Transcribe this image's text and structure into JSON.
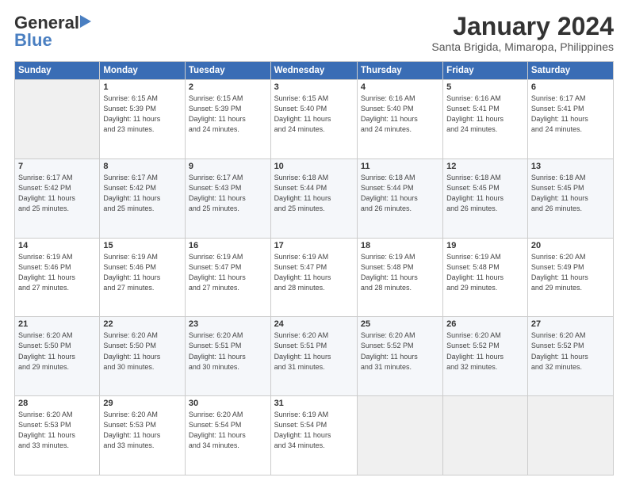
{
  "header": {
    "logo_line1": "General",
    "logo_line2": "Blue",
    "title": "January 2024",
    "subtitle": "Santa Brigida, Mimaropa, Philippines"
  },
  "calendar": {
    "days_of_week": [
      "Sunday",
      "Monday",
      "Tuesday",
      "Wednesday",
      "Thursday",
      "Friday",
      "Saturday"
    ],
    "weeks": [
      [
        {
          "day": "",
          "info": ""
        },
        {
          "day": "1",
          "info": "Sunrise: 6:15 AM\nSunset: 5:39 PM\nDaylight: 11 hours\nand 23 minutes."
        },
        {
          "day": "2",
          "info": "Sunrise: 6:15 AM\nSunset: 5:39 PM\nDaylight: 11 hours\nand 24 minutes."
        },
        {
          "day": "3",
          "info": "Sunrise: 6:15 AM\nSunset: 5:40 PM\nDaylight: 11 hours\nand 24 minutes."
        },
        {
          "day": "4",
          "info": "Sunrise: 6:16 AM\nSunset: 5:40 PM\nDaylight: 11 hours\nand 24 minutes."
        },
        {
          "day": "5",
          "info": "Sunrise: 6:16 AM\nSunset: 5:41 PM\nDaylight: 11 hours\nand 24 minutes."
        },
        {
          "day": "6",
          "info": "Sunrise: 6:17 AM\nSunset: 5:41 PM\nDaylight: 11 hours\nand 24 minutes."
        }
      ],
      [
        {
          "day": "7",
          "info": "Sunrise: 6:17 AM\nSunset: 5:42 PM\nDaylight: 11 hours\nand 25 minutes."
        },
        {
          "day": "8",
          "info": "Sunrise: 6:17 AM\nSunset: 5:42 PM\nDaylight: 11 hours\nand 25 minutes."
        },
        {
          "day": "9",
          "info": "Sunrise: 6:17 AM\nSunset: 5:43 PM\nDaylight: 11 hours\nand 25 minutes."
        },
        {
          "day": "10",
          "info": "Sunrise: 6:18 AM\nSunset: 5:44 PM\nDaylight: 11 hours\nand 25 minutes."
        },
        {
          "day": "11",
          "info": "Sunrise: 6:18 AM\nSunset: 5:44 PM\nDaylight: 11 hours\nand 26 minutes."
        },
        {
          "day": "12",
          "info": "Sunrise: 6:18 AM\nSunset: 5:45 PM\nDaylight: 11 hours\nand 26 minutes."
        },
        {
          "day": "13",
          "info": "Sunrise: 6:18 AM\nSunset: 5:45 PM\nDaylight: 11 hours\nand 26 minutes."
        }
      ],
      [
        {
          "day": "14",
          "info": "Sunrise: 6:19 AM\nSunset: 5:46 PM\nDaylight: 11 hours\nand 27 minutes."
        },
        {
          "day": "15",
          "info": "Sunrise: 6:19 AM\nSunset: 5:46 PM\nDaylight: 11 hours\nand 27 minutes."
        },
        {
          "day": "16",
          "info": "Sunrise: 6:19 AM\nSunset: 5:47 PM\nDaylight: 11 hours\nand 27 minutes."
        },
        {
          "day": "17",
          "info": "Sunrise: 6:19 AM\nSunset: 5:47 PM\nDaylight: 11 hours\nand 28 minutes."
        },
        {
          "day": "18",
          "info": "Sunrise: 6:19 AM\nSunset: 5:48 PM\nDaylight: 11 hours\nand 28 minutes."
        },
        {
          "day": "19",
          "info": "Sunrise: 6:19 AM\nSunset: 5:48 PM\nDaylight: 11 hours\nand 29 minutes."
        },
        {
          "day": "20",
          "info": "Sunrise: 6:20 AM\nSunset: 5:49 PM\nDaylight: 11 hours\nand 29 minutes."
        }
      ],
      [
        {
          "day": "21",
          "info": "Sunrise: 6:20 AM\nSunset: 5:50 PM\nDaylight: 11 hours\nand 29 minutes."
        },
        {
          "day": "22",
          "info": "Sunrise: 6:20 AM\nSunset: 5:50 PM\nDaylight: 11 hours\nand 30 minutes."
        },
        {
          "day": "23",
          "info": "Sunrise: 6:20 AM\nSunset: 5:51 PM\nDaylight: 11 hours\nand 30 minutes."
        },
        {
          "day": "24",
          "info": "Sunrise: 6:20 AM\nSunset: 5:51 PM\nDaylight: 11 hours\nand 31 minutes."
        },
        {
          "day": "25",
          "info": "Sunrise: 6:20 AM\nSunset: 5:52 PM\nDaylight: 11 hours\nand 31 minutes."
        },
        {
          "day": "26",
          "info": "Sunrise: 6:20 AM\nSunset: 5:52 PM\nDaylight: 11 hours\nand 32 minutes."
        },
        {
          "day": "27",
          "info": "Sunrise: 6:20 AM\nSunset: 5:52 PM\nDaylight: 11 hours\nand 32 minutes."
        }
      ],
      [
        {
          "day": "28",
          "info": "Sunrise: 6:20 AM\nSunset: 5:53 PM\nDaylight: 11 hours\nand 33 minutes."
        },
        {
          "day": "29",
          "info": "Sunrise: 6:20 AM\nSunset: 5:53 PM\nDaylight: 11 hours\nand 33 minutes."
        },
        {
          "day": "30",
          "info": "Sunrise: 6:20 AM\nSunset: 5:54 PM\nDaylight: 11 hours\nand 34 minutes."
        },
        {
          "day": "31",
          "info": "Sunrise: 6:19 AM\nSunset: 5:54 PM\nDaylight: 11 hours\nand 34 minutes."
        },
        {
          "day": "",
          "info": ""
        },
        {
          "day": "",
          "info": ""
        },
        {
          "day": "",
          "info": ""
        }
      ]
    ]
  }
}
